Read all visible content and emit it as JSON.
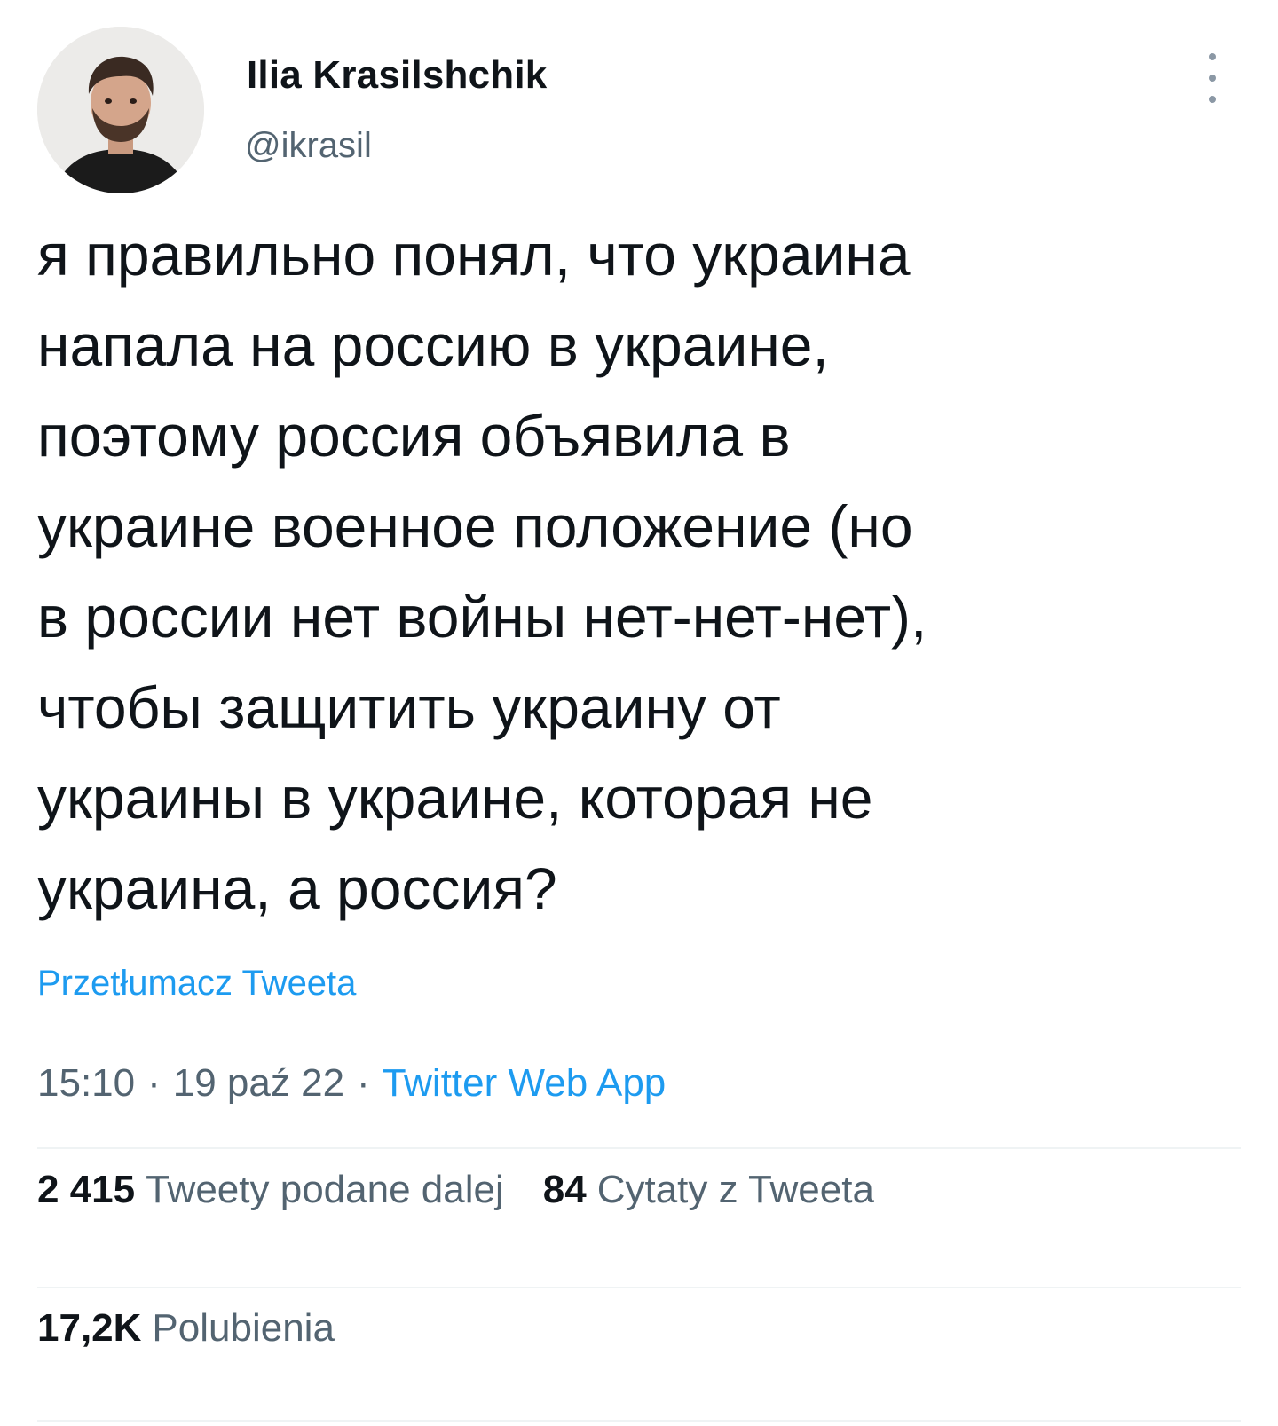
{
  "author": {
    "display_name": "Ilia Krasilshchik",
    "handle": "@ikrasil"
  },
  "tweet": {
    "lines": [
      "я правильно понял, что украина",
      "напала на россию в украине,",
      "поэтому россия объявила в",
      "украине военное положение (но",
      "в россии нет войны нет-нет-нет),",
      "чтобы защитить украину от",
      "украины в украине, которая не",
      "украина, а россия?"
    ],
    "translate_label": "Przetłumacz Tweeta",
    "time": "15:10",
    "date": "19 paź 22",
    "separator": "·",
    "source": "Twitter Web App"
  },
  "stats": {
    "retweets_count": "2 415",
    "retweets_label": "Tweety podane dalej",
    "quotes_count": "84",
    "quotes_label": "Cytaty z Tweeta",
    "likes_count": "17,2K",
    "likes_label": "Polubienia"
  },
  "colors": {
    "link": "#1d9bf0",
    "secondary_text": "#536471",
    "primary_text": "#0f1419",
    "divider": "#eff3f4"
  },
  "icons": {
    "more": "more-vertical-icon"
  }
}
